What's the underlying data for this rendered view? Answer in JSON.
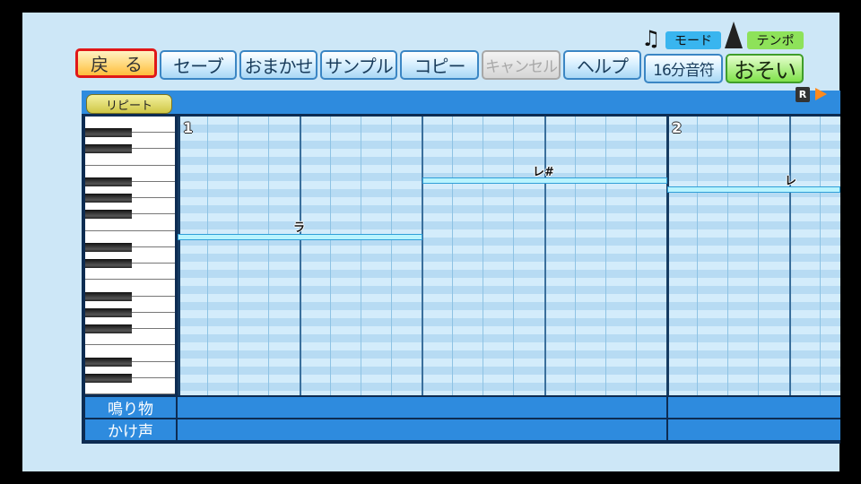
{
  "toolbar": {
    "buttons": [
      {
        "label": "戻　る",
        "state": "selected"
      },
      {
        "label": "セーブ",
        "state": "normal"
      },
      {
        "label": "おまかせ",
        "state": "normal"
      },
      {
        "label": "サンプル",
        "state": "normal"
      },
      {
        "label": "コピー",
        "state": "normal"
      },
      {
        "label": "キャンセル",
        "state": "disabled"
      },
      {
        "label": "ヘルプ",
        "state": "normal"
      }
    ],
    "mode_tag": "モード",
    "mode_value": "16分音符",
    "tempo_tag": "テンポ",
    "tempo_value": "おそい"
  },
  "editor": {
    "repeat_label": "リピート",
    "r_badge": "R",
    "measures": [
      "1",
      "2"
    ],
    "notes": [
      {
        "label": "ラ",
        "measure": 1,
        "start_step": 0,
        "length_steps": 8,
        "pitch_row": 13
      },
      {
        "label": "レ#",
        "measure": 1,
        "start_step": 8,
        "length_steps": 8,
        "pitch_row": 6
      },
      {
        "label": "レ",
        "measure": 2,
        "start_step": 0,
        "length_steps": 6,
        "pitch_row": 7
      }
    ]
  },
  "tracks": [
    "鳴り物",
    "かけ声"
  ],
  "colors": {
    "accent_blue": "#2e8bde",
    "selected_border": "#e01818",
    "tempo_green": "#7fe24a",
    "note_fill": "#b9f4ff"
  }
}
